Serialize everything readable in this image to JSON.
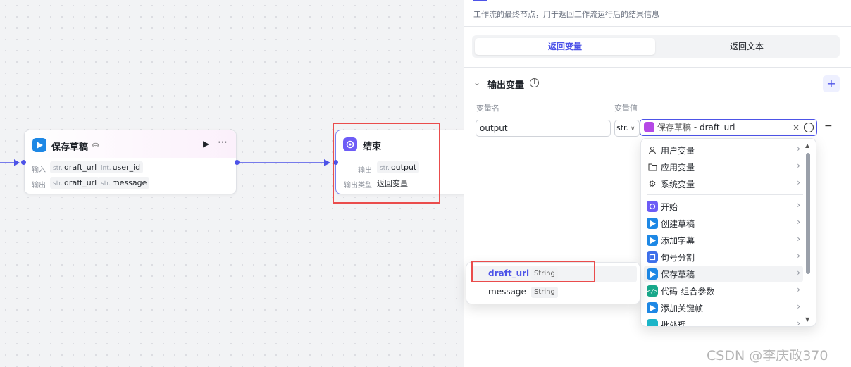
{
  "canvas": {
    "save_node": {
      "title": "保存草稿",
      "input_label": "输入",
      "output_label": "输出",
      "inputs": [
        {
          "type": "str.",
          "name": "draft_url"
        },
        {
          "type": "int.",
          "name": "user_id"
        }
      ],
      "outputs": [
        {
          "type": "str.",
          "name": "draft_url"
        },
        {
          "type": "str.",
          "name": "message"
        }
      ]
    },
    "end_node": {
      "title": "结束",
      "output_label": "输出",
      "output_type": "str.",
      "output_name": "output",
      "type_label": "输出类型",
      "type_value": "返回变量"
    }
  },
  "panel": {
    "description": "工作流的最终节点，用于返回工作流运行后的结果信息",
    "tabs": [
      "返回变量",
      "返回文本"
    ],
    "section_title": "输出变量",
    "col_name": "变量名",
    "col_value": "变量值",
    "var_name": "output",
    "var_type": "str.",
    "var_ref_node": "保存草稿",
    "var_ref_sep": " - ",
    "var_ref_field": "draft_url",
    "clear_glyph": "×",
    "add_glyph": "+",
    "remove_glyph": "−"
  },
  "dropdown": {
    "groups": [
      {
        "label": "用户变量",
        "icon": "user-icon"
      },
      {
        "label": "应用变量",
        "icon": "folder-icon"
      },
      {
        "label": "系统变量",
        "icon": "gear-icon"
      }
    ],
    "nodes": [
      {
        "label": "开始",
        "icon": "start-node-icon"
      },
      {
        "label": "创建草稿",
        "icon": "plugin-icon"
      },
      {
        "label": "添加字幕",
        "icon": "plugin-icon"
      },
      {
        "label": "句号分割",
        "icon": "split-icon"
      },
      {
        "label": "保存草稿",
        "icon": "plugin-icon"
      },
      {
        "label": "代码-组合参数",
        "icon": "code-icon"
      },
      {
        "label": "添加关键帧",
        "icon": "plugin-icon"
      },
      {
        "label": "批处理",
        "icon": "batch-icon"
      }
    ],
    "submenu": [
      {
        "name": "draft_url",
        "type": "String"
      },
      {
        "name": "message",
        "type": "String"
      }
    ]
  },
  "watermark": "CSDN @李庆政370",
  "colors": {
    "accent": "#4d53e8",
    "highlight": "#ea4c4c",
    "plugin": "#1e88e5",
    "start": "#6d5cf6"
  }
}
